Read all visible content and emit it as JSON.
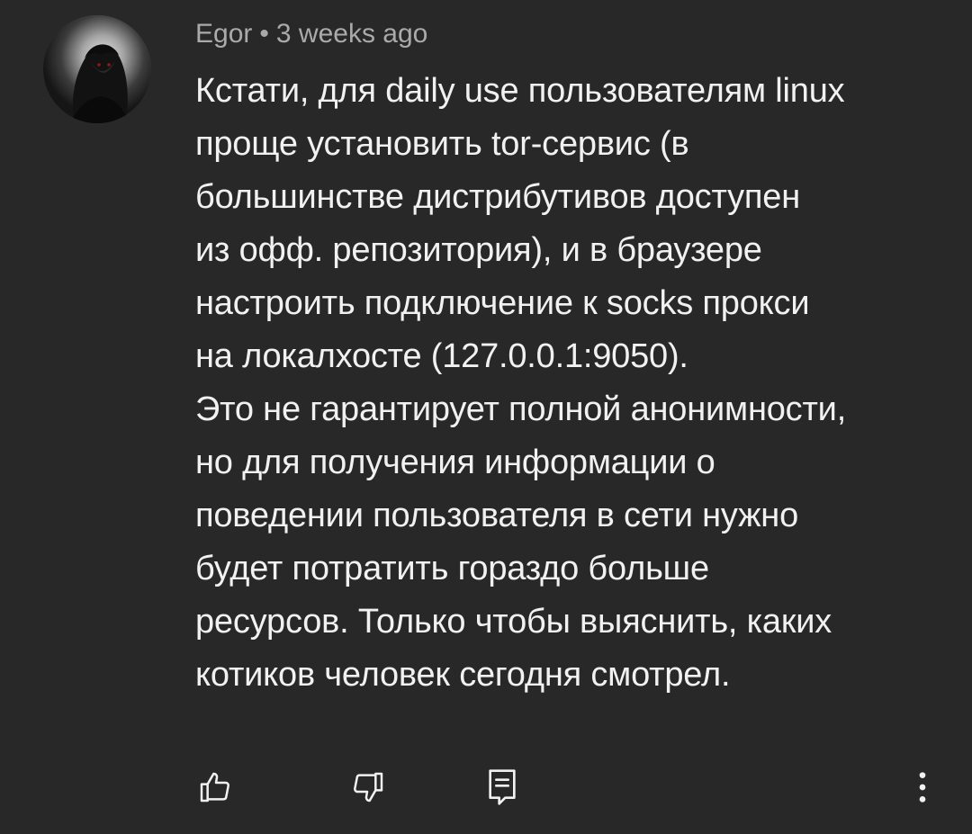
{
  "comment": {
    "author": "Egor",
    "separator": "•",
    "time": "3 weeks ago",
    "lines": [
      "Кстати, для daily use пользователям linux",
      "проще установить tor-сервис (в",
      "большинстве дистрибутивов доступен",
      "из офф. репозитория), и в браузере",
      "настроить подключение к socks прокси",
      "на локалхосте (127.0.0.1:9050).",
      "Это не гарантирует полной анонимности,",
      "но для получения информации о",
      "поведении пользователя в сети нужно",
      "будет потратить гораздо больше",
      "ресурсов. Только чтобы выяснить, каких",
      "котиков человек сегодня смотрел."
    ]
  },
  "actions": {
    "like_icon": "thumbs-up-icon",
    "dislike_icon": "thumbs-down-icon",
    "reply_icon": "reply-comment-icon",
    "more_icon": "more-vertical-icon"
  },
  "colors": {
    "background": "#282828",
    "text": "#f1f1f1",
    "meta": "#aaaaaa"
  }
}
